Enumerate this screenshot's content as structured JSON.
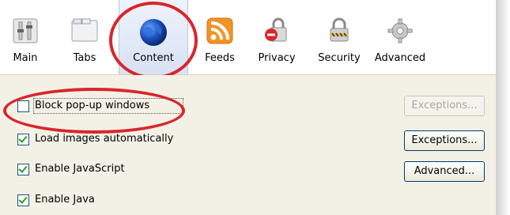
{
  "toolbar": {
    "tabs": [
      {
        "label": "Main",
        "icon": "switch-icon",
        "selected": false
      },
      {
        "label": "Tabs",
        "icon": "tabs-window-icon",
        "selected": false
      },
      {
        "label": "Content",
        "icon": "globe-icon",
        "selected": true
      },
      {
        "label": "Feeds",
        "icon": "rss-icon",
        "selected": false
      },
      {
        "label": "Privacy",
        "icon": "lock-no-icon",
        "selected": false
      },
      {
        "label": "Security",
        "icon": "padlock-icon",
        "selected": false
      },
      {
        "label": "Advanced",
        "icon": "gear-icon",
        "selected": false
      }
    ]
  },
  "content": {
    "options": [
      {
        "label": "Block pop-up windows",
        "checked": false
      },
      {
        "label": "Load images automatically",
        "checked": true
      },
      {
        "label": "Enable JavaScript",
        "checked": true
      },
      {
        "label": "Enable Java",
        "checked": true
      }
    ],
    "buttons": {
      "exceptions_popups": "Exceptions...",
      "exceptions_images": "Exceptions...",
      "advanced_js": "Advanced..."
    }
  },
  "colors": {
    "annotation_red": "#d8262b",
    "dialog_bg": "#f3f1e6",
    "checkmark_green": "#21a121"
  }
}
